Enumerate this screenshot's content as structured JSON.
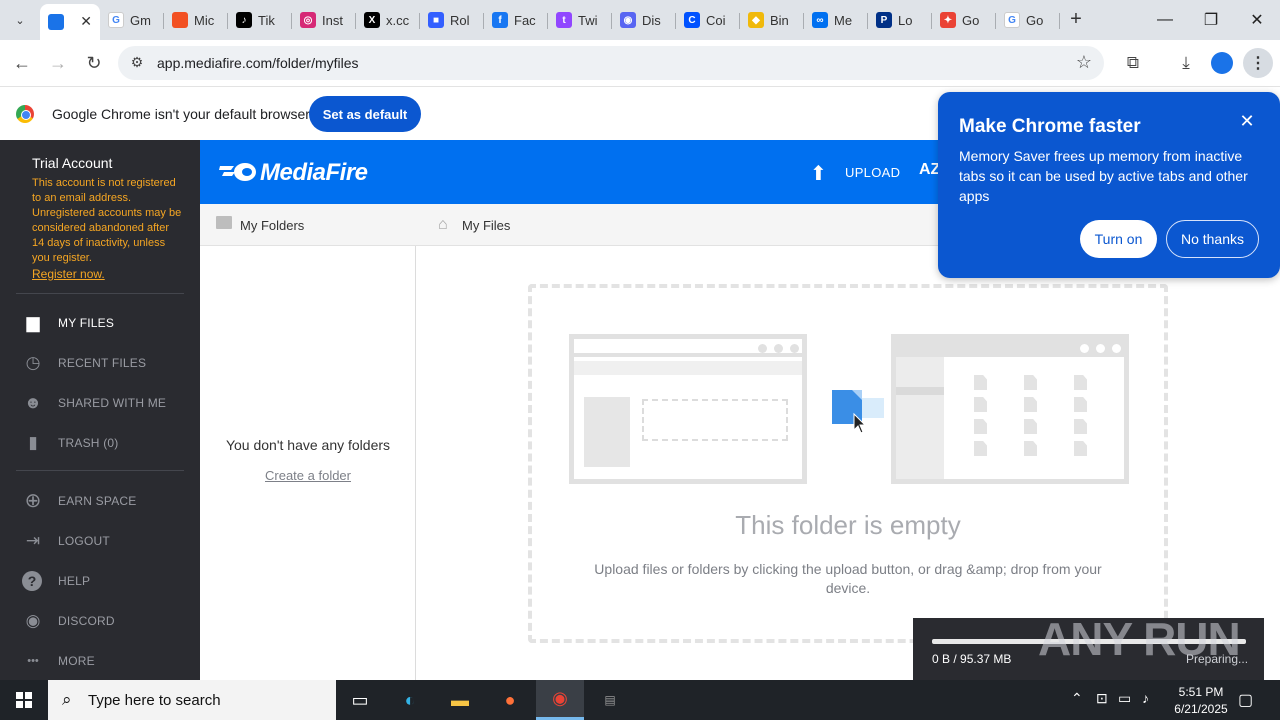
{
  "browser": {
    "tabs": [
      {
        "label": "",
        "fav_char": "",
        "fav_color": "#1a73e8",
        "active": true
      },
      {
        "label": "Gm",
        "fav_char": "G",
        "fav_color": "#ffffff"
      },
      {
        "label": "Mic",
        "fav_char": "",
        "fav_color": "#f25022"
      },
      {
        "label": "Tik",
        "fav_char": "♪",
        "fav_color": "#000000"
      },
      {
        "label": "Inst",
        "fav_char": "◎",
        "fav_color": "#d62976"
      },
      {
        "label": "x.cc",
        "fav_char": "X",
        "fav_color": "#000000"
      },
      {
        "label": "Rol",
        "fav_char": "■",
        "fav_color": "#335fff"
      },
      {
        "label": "Fac",
        "fav_char": "f",
        "fav_color": "#1877f2"
      },
      {
        "label": "Twi",
        "fav_char": "t",
        "fav_color": "#9146ff"
      },
      {
        "label": "Dis",
        "fav_char": "◉",
        "fav_color": "#5865f2"
      },
      {
        "label": "Coi",
        "fav_char": "C",
        "fav_color": "#0052ff"
      },
      {
        "label": "Bin",
        "fav_char": "◆",
        "fav_color": "#f0b90b"
      },
      {
        "label": "Me",
        "fav_char": "∞",
        "fav_color": "#0070f0"
      },
      {
        "label": "Lo",
        "fav_char": "P",
        "fav_color": "#003087"
      },
      {
        "label": "Go",
        "fav_char": "✦",
        "fav_color": "#ea4335"
      },
      {
        "label": "Go",
        "fav_char": "G",
        "fav_color": "#ffffff"
      }
    ],
    "url": "app.mediafire.com/folder/myfiles",
    "default_bar": {
      "message": "Google Chrome isn't your default browser",
      "button": "Set as default"
    },
    "promo": {
      "title": "Make Chrome faster",
      "body": "Memory Saver frees up memory from inactive tabs so it can be used by active tabs and other apps",
      "turn_on": "Turn on",
      "no_thanks": "No thanks"
    }
  },
  "sidebar": {
    "trial_title": "Trial Account",
    "trial_note": "This account is not registered to an email address. Unregistered accounts may be considered abandoned after 14 days of inactivity, unless you register.",
    "register_link": "Register now.",
    "items": [
      {
        "label": "MY FILES",
        "icon": "folder-icon",
        "active": true
      },
      {
        "label": "RECENT FILES",
        "icon": "clock-icon"
      },
      {
        "label": "SHARED WITH ME",
        "icon": "users-icon"
      },
      {
        "label": "TRASH (0)",
        "icon": "trash-icon"
      },
      {
        "label": "EARN SPACE",
        "icon": "plus-circle-icon"
      },
      {
        "label": "LOGOUT",
        "icon": "logout-icon"
      },
      {
        "label": "HELP",
        "icon": "help-icon"
      },
      {
        "label": "DISCORD",
        "icon": "discord-icon"
      },
      {
        "label": "MORE",
        "icon": "more-icon"
      }
    ]
  },
  "header": {
    "logo": "MediaFire",
    "upload": "UPLOAD"
  },
  "folders": {
    "heading": "My Folders",
    "empty": "You don't have any folders",
    "create": "Create a folder"
  },
  "main": {
    "breadcrumb": "My Files",
    "empty_title": "This folder is empty",
    "empty_sub": "Upload files or folders by clicking the upload button, or drag &amp; drop from your device."
  },
  "upload_toast": {
    "size": "0 B / 95.37 MB",
    "status": "Preparing...",
    "progress": 0
  },
  "watermark": "ANY RUN",
  "taskbar": {
    "search_placeholder": "Type here to search",
    "time": "5:51 PM",
    "date": "6/21/2025"
  },
  "colors": {
    "mediafire_blue": "#0070f0",
    "chrome_blue": "#0b57d0",
    "sidebar_bg": "#2a2b30",
    "warning_orange": "#f5a623"
  }
}
